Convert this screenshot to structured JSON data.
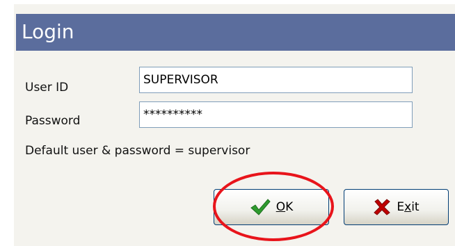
{
  "window": {
    "title": "Login"
  },
  "form": {
    "user_id": {
      "label": "User ID",
      "value": "SUPERVISOR"
    },
    "password": {
      "label": "Password",
      "value": "**********"
    },
    "hint": "Default user & password = supervisor"
  },
  "buttons": {
    "ok": {
      "label_mnemonic": "O",
      "label_rest": "K",
      "icon": "checkmark-icon",
      "icon_color": "#2e9b2e"
    },
    "exit": {
      "label_start": "E",
      "label_mnemonic": "x",
      "label_rest": "it",
      "icon": "x-icon",
      "icon_color": "#c00000"
    }
  },
  "annotation": {
    "color": "#e8141b",
    "target": "ok-button"
  },
  "colors": {
    "title_bar": "#5b6d9d",
    "dialog_background": "#f4f3ee",
    "field_border": "#7f9db9"
  }
}
